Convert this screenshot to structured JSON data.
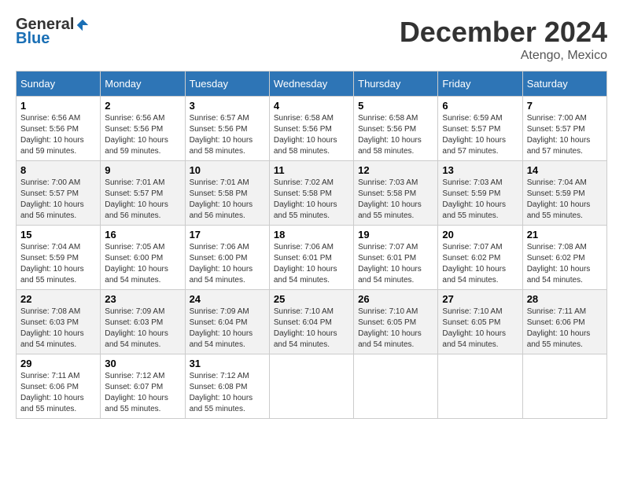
{
  "logo": {
    "general": "General",
    "blue": "Blue"
  },
  "title": "December 2024",
  "location": "Atengo, Mexico",
  "weekdays": [
    "Sunday",
    "Monday",
    "Tuesday",
    "Wednesday",
    "Thursday",
    "Friday",
    "Saturday"
  ],
  "weeks": [
    [
      {
        "day": "1",
        "sunrise": "6:56 AM",
        "sunset": "5:56 PM",
        "daylight": "10 hours and 59 minutes."
      },
      {
        "day": "2",
        "sunrise": "6:56 AM",
        "sunset": "5:56 PM",
        "daylight": "10 hours and 59 minutes."
      },
      {
        "day": "3",
        "sunrise": "6:57 AM",
        "sunset": "5:56 PM",
        "daylight": "10 hours and 58 minutes."
      },
      {
        "day": "4",
        "sunrise": "6:58 AM",
        "sunset": "5:56 PM",
        "daylight": "10 hours and 58 minutes."
      },
      {
        "day": "5",
        "sunrise": "6:58 AM",
        "sunset": "5:56 PM",
        "daylight": "10 hours and 58 minutes."
      },
      {
        "day": "6",
        "sunrise": "6:59 AM",
        "sunset": "5:57 PM",
        "daylight": "10 hours and 57 minutes."
      },
      {
        "day": "7",
        "sunrise": "7:00 AM",
        "sunset": "5:57 PM",
        "daylight": "10 hours and 57 minutes."
      }
    ],
    [
      {
        "day": "8",
        "sunrise": "7:00 AM",
        "sunset": "5:57 PM",
        "daylight": "10 hours and 56 minutes."
      },
      {
        "day": "9",
        "sunrise": "7:01 AM",
        "sunset": "5:57 PM",
        "daylight": "10 hours and 56 minutes."
      },
      {
        "day": "10",
        "sunrise": "7:01 AM",
        "sunset": "5:58 PM",
        "daylight": "10 hours and 56 minutes."
      },
      {
        "day": "11",
        "sunrise": "7:02 AM",
        "sunset": "5:58 PM",
        "daylight": "10 hours and 55 minutes."
      },
      {
        "day": "12",
        "sunrise": "7:03 AM",
        "sunset": "5:58 PM",
        "daylight": "10 hours and 55 minutes."
      },
      {
        "day": "13",
        "sunrise": "7:03 AM",
        "sunset": "5:59 PM",
        "daylight": "10 hours and 55 minutes."
      },
      {
        "day": "14",
        "sunrise": "7:04 AM",
        "sunset": "5:59 PM",
        "daylight": "10 hours and 55 minutes."
      }
    ],
    [
      {
        "day": "15",
        "sunrise": "7:04 AM",
        "sunset": "5:59 PM",
        "daylight": "10 hours and 55 minutes."
      },
      {
        "day": "16",
        "sunrise": "7:05 AM",
        "sunset": "6:00 PM",
        "daylight": "10 hours and 54 minutes."
      },
      {
        "day": "17",
        "sunrise": "7:06 AM",
        "sunset": "6:00 PM",
        "daylight": "10 hours and 54 minutes."
      },
      {
        "day": "18",
        "sunrise": "7:06 AM",
        "sunset": "6:01 PM",
        "daylight": "10 hours and 54 minutes."
      },
      {
        "day": "19",
        "sunrise": "7:07 AM",
        "sunset": "6:01 PM",
        "daylight": "10 hours and 54 minutes."
      },
      {
        "day": "20",
        "sunrise": "7:07 AM",
        "sunset": "6:02 PM",
        "daylight": "10 hours and 54 minutes."
      },
      {
        "day": "21",
        "sunrise": "7:08 AM",
        "sunset": "6:02 PM",
        "daylight": "10 hours and 54 minutes."
      }
    ],
    [
      {
        "day": "22",
        "sunrise": "7:08 AM",
        "sunset": "6:03 PM",
        "daylight": "10 hours and 54 minutes."
      },
      {
        "day": "23",
        "sunrise": "7:09 AM",
        "sunset": "6:03 PM",
        "daylight": "10 hours and 54 minutes."
      },
      {
        "day": "24",
        "sunrise": "7:09 AM",
        "sunset": "6:04 PM",
        "daylight": "10 hours and 54 minutes."
      },
      {
        "day": "25",
        "sunrise": "7:10 AM",
        "sunset": "6:04 PM",
        "daylight": "10 hours and 54 minutes."
      },
      {
        "day": "26",
        "sunrise": "7:10 AM",
        "sunset": "6:05 PM",
        "daylight": "10 hours and 54 minutes."
      },
      {
        "day": "27",
        "sunrise": "7:10 AM",
        "sunset": "6:05 PM",
        "daylight": "10 hours and 54 minutes."
      },
      {
        "day": "28",
        "sunrise": "7:11 AM",
        "sunset": "6:06 PM",
        "daylight": "10 hours and 55 minutes."
      }
    ],
    [
      {
        "day": "29",
        "sunrise": "7:11 AM",
        "sunset": "6:06 PM",
        "daylight": "10 hours and 55 minutes."
      },
      {
        "day": "30",
        "sunrise": "7:12 AM",
        "sunset": "6:07 PM",
        "daylight": "10 hours and 55 minutes."
      },
      {
        "day": "31",
        "sunrise": "7:12 AM",
        "sunset": "6:08 PM",
        "daylight": "10 hours and 55 minutes."
      },
      null,
      null,
      null,
      null
    ]
  ],
  "labels": {
    "sunrise": "Sunrise:",
    "sunset": "Sunset:",
    "daylight": "Daylight:"
  }
}
